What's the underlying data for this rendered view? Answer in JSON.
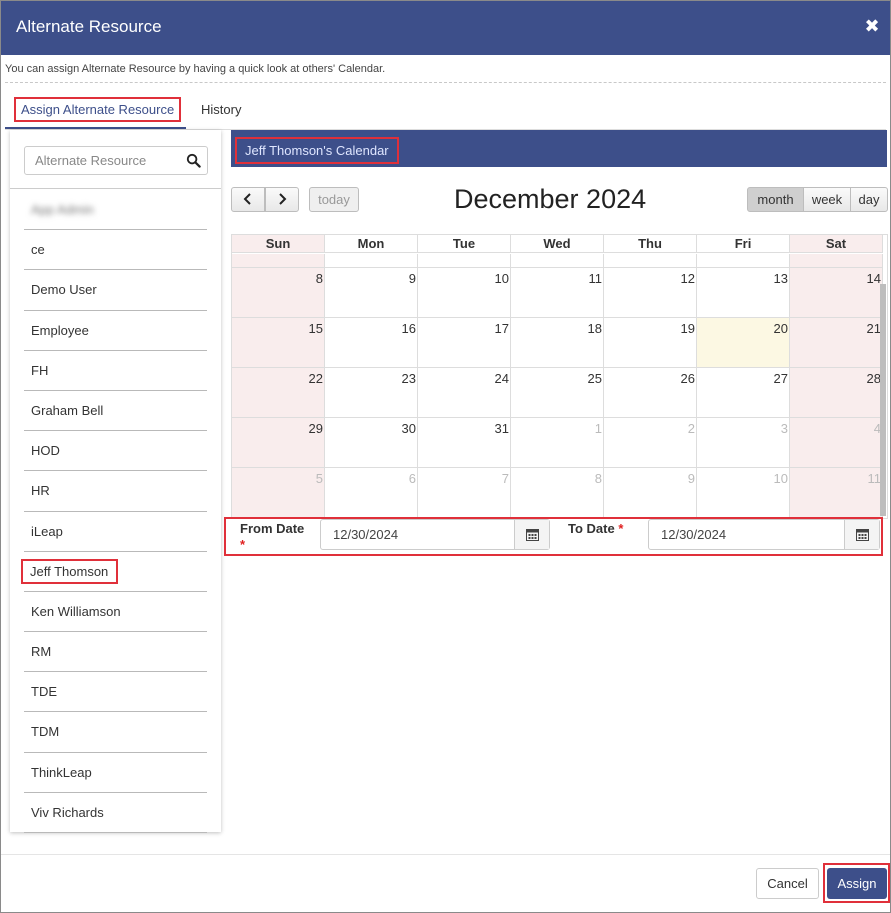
{
  "dialog": {
    "title": "Alternate Resource",
    "close_glyph": "✖",
    "info_text": "You can assign Alternate Resource by having a quick look at others' Calendar."
  },
  "tabs": [
    {
      "label": "Assign Alternate Resource",
      "active": true
    },
    {
      "label": "History",
      "active": false
    }
  ],
  "resource_list": {
    "search_placeholder": "Alternate Resource",
    "search_icon": "search-icon",
    "items": [
      {
        "label": "App Admin",
        "blurred": true
      },
      {
        "label": "ce"
      },
      {
        "label": "Demo User"
      },
      {
        "label": "Employee"
      },
      {
        "label": "FH"
      },
      {
        "label": "Graham Bell"
      },
      {
        "label": "HOD"
      },
      {
        "label": "HR"
      },
      {
        "label": "iLeap"
      },
      {
        "label": "Jeff Thomson",
        "selected": true
      },
      {
        "label": "Ken Williamson"
      },
      {
        "label": "RM"
      },
      {
        "label": "TDE"
      },
      {
        "label": "TDM"
      },
      {
        "label": "ThinkLeap"
      },
      {
        "label": "Viv Richards"
      }
    ]
  },
  "calendar": {
    "header_title": "Jeff Thomson's Calendar",
    "month_title": "December 2024",
    "today_label": "today",
    "views": {
      "month": "month",
      "week": "week",
      "day": "day"
    },
    "active_view": "month",
    "day_headers": [
      "Sun",
      "Mon",
      "Tue",
      "Wed",
      "Thu",
      "Fri",
      "Sat"
    ],
    "weeks": [
      [
        {
          "d": "8"
        },
        {
          "d": "9"
        },
        {
          "d": "10"
        },
        {
          "d": "11"
        },
        {
          "d": "12"
        },
        {
          "d": "13"
        },
        {
          "d": "14"
        }
      ],
      [
        {
          "d": "15"
        },
        {
          "d": "16"
        },
        {
          "d": "17"
        },
        {
          "d": "18"
        },
        {
          "d": "19"
        },
        {
          "d": "20",
          "today": true
        },
        {
          "d": "21"
        }
      ],
      [
        {
          "d": "22"
        },
        {
          "d": "23"
        },
        {
          "d": "24"
        },
        {
          "d": "25"
        },
        {
          "d": "26"
        },
        {
          "d": "27"
        },
        {
          "d": "28"
        }
      ],
      [
        {
          "d": "29"
        },
        {
          "d": "30"
        },
        {
          "d": "31"
        },
        {
          "d": "1",
          "other": true
        },
        {
          "d": "2",
          "other": true
        },
        {
          "d": "3",
          "other": true
        },
        {
          "d": "4",
          "other": true
        }
      ],
      [
        {
          "d": "5",
          "other": true
        },
        {
          "d": "6",
          "other": true
        },
        {
          "d": "7",
          "other": true
        },
        {
          "d": "8",
          "other": true
        },
        {
          "d": "9",
          "other": true
        },
        {
          "d": "10",
          "other": true
        },
        {
          "d": "11",
          "other": true
        }
      ]
    ]
  },
  "dates": {
    "from_label": "From Date",
    "from_value": "12/30/2024",
    "to_label": "To Date",
    "to_value": "12/30/2024",
    "required_mark": "*"
  },
  "footer": {
    "cancel_label": "Cancel",
    "assign_label": "Assign"
  },
  "colors": {
    "primary": "#3d4f8a",
    "highlight": "#e0303a",
    "weekend": "#f9eded",
    "today": "#fcf8e3"
  }
}
